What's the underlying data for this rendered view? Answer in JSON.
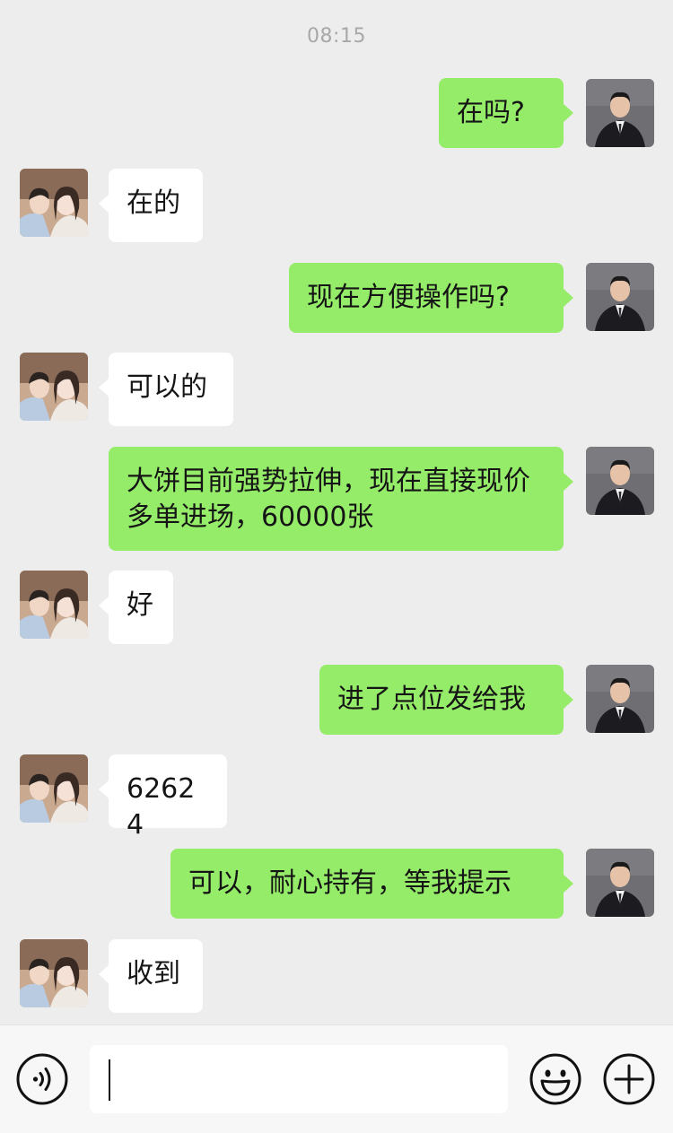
{
  "status": {
    "time": "08:15"
  },
  "messages": [
    {
      "side": "sent",
      "text": "在吗?"
    },
    {
      "side": "recv",
      "text": "在的"
    },
    {
      "side": "sent",
      "text": "现在方便操作吗?"
    },
    {
      "side": "recv",
      "text": "可以的"
    },
    {
      "side": "sent",
      "text": "大饼目前强势拉伸，现在直接现价多单进场，60000张"
    },
    {
      "side": "recv",
      "text": "好"
    },
    {
      "side": "sent",
      "text": "进了点位发给我"
    },
    {
      "side": "recv",
      "text": "62624"
    },
    {
      "side": "sent",
      "text": "可以，耐心持有，等我提示"
    },
    {
      "side": "recv",
      "text": "收到"
    }
  ],
  "input_bar": {
    "input_value": "",
    "voice_icon": "voice-icon",
    "emoji_icon": "emoji-icon",
    "plus_icon": "plus-icon"
  },
  "colors": {
    "background": "#ededed",
    "sent_bubble": "#95ec69",
    "recv_bubble": "#ffffff",
    "input_bar": "#f7f7f7",
    "timestamp": "#a8a8a8"
  }
}
